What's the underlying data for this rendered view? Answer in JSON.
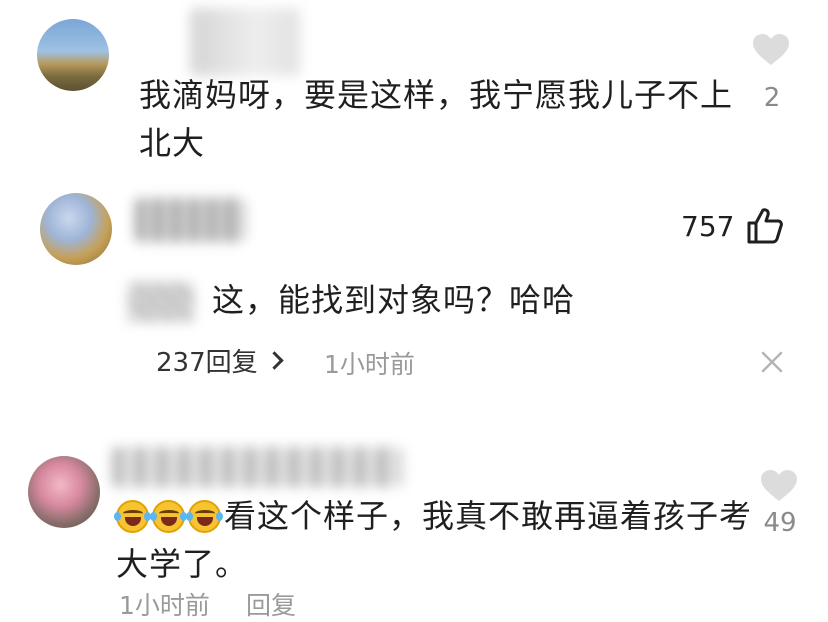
{
  "comments": [
    {
      "text": "我滴妈呀，要是这样，我宁愿我儿子不上北大",
      "likes": "2"
    },
    {
      "text": "这，能找到对象吗？哈哈",
      "likes": "757",
      "reply_label": "237回复",
      "time": "1小时前"
    },
    {
      "text": "看这个样子，我真不敢再逼着孩子考大学了。",
      "emoji_count": 3,
      "emoji": "laughing-tears-emoji",
      "likes": "49",
      "time": "1小时前",
      "reply_label": "回复"
    }
  ],
  "colors": {
    "text": "#1f1f1f",
    "muted": "#9a9a9a",
    "heart": "#dcdcdc"
  },
  "icons": [
    "heart-icon",
    "thumbs-up-icon",
    "chevron-right-icon",
    "close-icon"
  ]
}
